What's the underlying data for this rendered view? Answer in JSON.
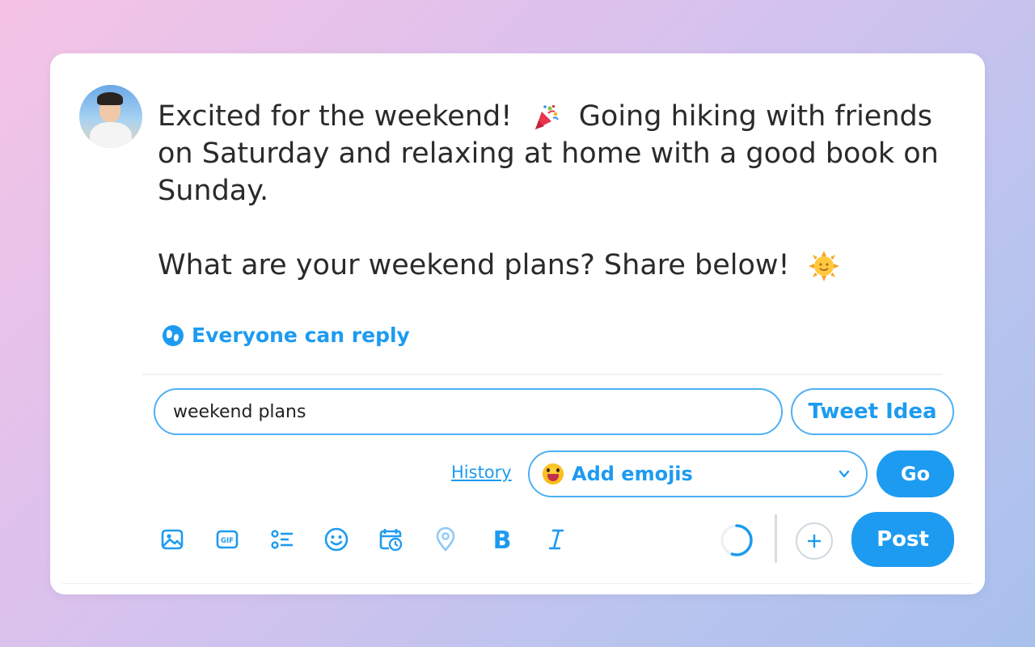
{
  "tweet": {
    "line1": "Excited for the weekend!  ",
    "line1b": "  Going hiking with friends",
    "line2": "on Saturday and relaxing at home with a good book on",
    "line3": "Sunday.",
    "line5": "What are your weekend plans? Share below!  ",
    "emoji_party": "party-popper-icon",
    "emoji_sun": "sun-with-face-icon"
  },
  "reply_setting": {
    "label": "Everyone can reply"
  },
  "idea_tool": {
    "input_value": "weekend plans",
    "tweet_idea_label": "Tweet Idea",
    "history_label": "History",
    "emoji_select_label": "Add emojis",
    "go_label": "Go"
  },
  "toolbar": {
    "icons": [
      "image-icon",
      "gif-icon",
      "poll-icon",
      "emoji-icon",
      "schedule-icon",
      "location-icon",
      "bold-icon",
      "italic-icon"
    ],
    "post_label": "Post",
    "char_progress": 0.55
  },
  "colors": {
    "accent": "#1d9bf0",
    "text": "#2a2a2a",
    "border": "#4fb0f2"
  }
}
